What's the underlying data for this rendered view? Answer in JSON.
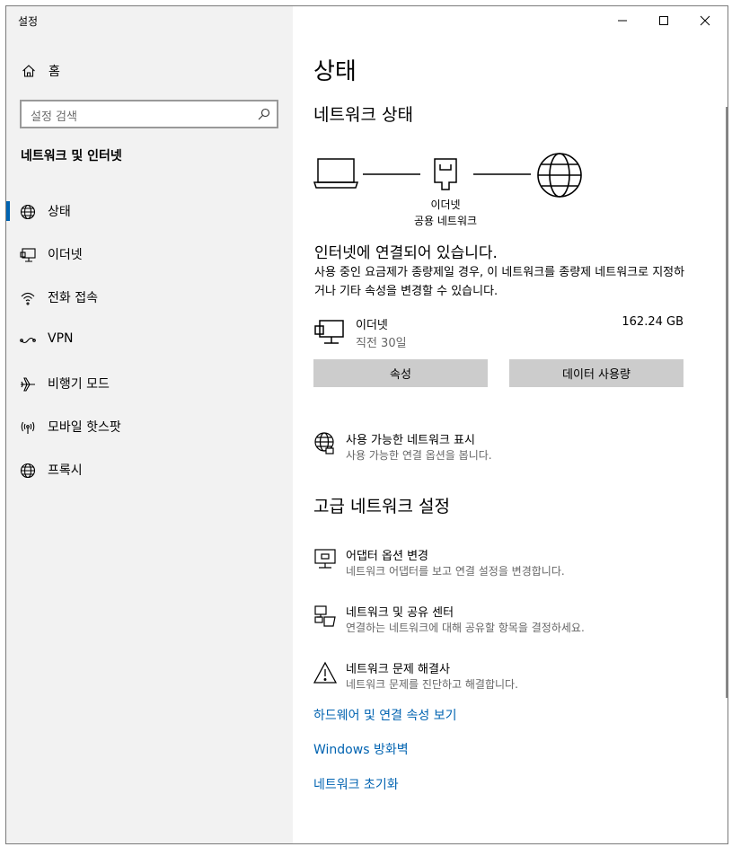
{
  "window": {
    "title": "설정"
  },
  "sidebar": {
    "home_label": "홈",
    "search_placeholder": "설정 검색",
    "section_title": "네트워크 및 인터넷",
    "items": [
      {
        "label": "상태",
        "icon": "globe-icon"
      },
      {
        "label": "이더넷",
        "icon": "ethernet-icon"
      },
      {
        "label": "전화 접속",
        "icon": "dialup-icon"
      },
      {
        "label": "VPN",
        "icon": "vpn-icon"
      },
      {
        "label": "비행기 모드",
        "icon": "airplane-icon"
      },
      {
        "label": "모바일 핫스팟",
        "icon": "hotspot-icon"
      },
      {
        "label": "프록시",
        "icon": "globe-icon"
      }
    ]
  },
  "main": {
    "title": "상태",
    "network_status_heading": "네트워크 상태",
    "diagram": {
      "label_line1": "이더넷",
      "label_line2": "공용 네트워크"
    },
    "status_headline": "인터넷에 연결되어 있습니다.",
    "status_description": "사용 중인 요금제가 종량제일 경우, 이 네트워크를 종량제 네트워크로 지정하거나 기타 속성을 변경할 수 있습니다.",
    "connection": {
      "name": "이더넷",
      "sub": "직전 30일",
      "usage": "162.24 GB"
    },
    "buttons": {
      "properties": "속성",
      "data_usage": "데이터 사용량"
    },
    "available_networks": {
      "title": "사용 가능한 네트워크 표시",
      "sub": "사용 가능한 연결 옵션을 봅니다."
    },
    "advanced_heading": "고급 네트워크 설정",
    "advanced": [
      {
        "title": "어댑터 옵션 변경",
        "sub": "네트워크 어댑터를 보고 연결 설정을 변경합니다."
      },
      {
        "title": "네트워크 및 공유 센터",
        "sub": "연결하는 네트워크에 대해 공유할 항목을 결정하세요."
      },
      {
        "title": "네트워크 문제 해결사",
        "sub": "네트워크 문제를 진단하고 해결합니다."
      }
    ],
    "links": [
      "하드웨어 및 연결 속성 보기",
      "Windows 방화벽",
      "네트워크 초기화"
    ]
  },
  "colors": {
    "accent": "#0063b1",
    "sidebar_bg": "#f2f2f2",
    "button_bg": "#cccccc"
  }
}
